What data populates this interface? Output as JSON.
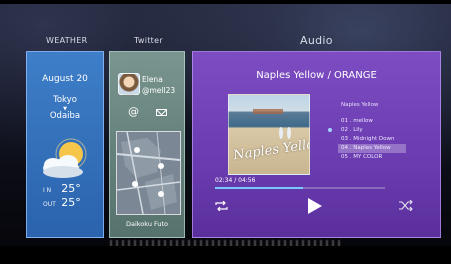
{
  "sections": {
    "weather_label": "WEATHER",
    "twitter_label": "Twitter",
    "audio_label": "Audio"
  },
  "weather": {
    "date": "August 20",
    "from": "Tokyo",
    "arrow": "▼",
    "to": "Odaiba",
    "icon": "partly-cloudy-icon",
    "in_label": "I N",
    "in_temp": "25°",
    "out_label": "OUT",
    "out_temp": "25°"
  },
  "twitter": {
    "name": "Elena",
    "handle": "@mell23",
    "at_symbol": "@",
    "location": "Daikoku Futo"
  },
  "audio": {
    "title": "Naples Yellow / ORANGE",
    "cover_text": "Naples Yellow",
    "album": "Naples  Yellow",
    "tracks": [
      "01 . mellow",
      "02 . Lily",
      "03 . Midnight Down",
      "04 . Naples Yellow",
      "05 . MY COLOR"
    ],
    "active_track_index": 3,
    "time": "02:34 / 04:56",
    "progress": 0.52
  },
  "colors": {
    "weather_bg": "#2f6bb8",
    "twitter_bg": "#8fb5a8",
    "audio_bg": "#6a3cb0",
    "progress": "#78c8ff"
  }
}
